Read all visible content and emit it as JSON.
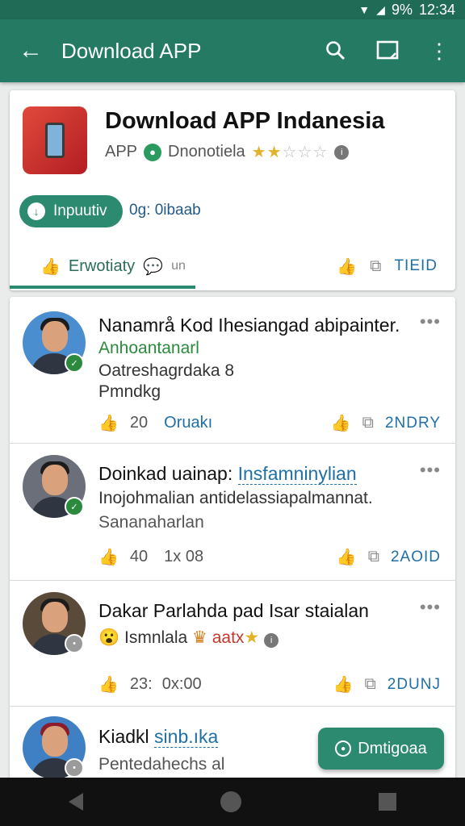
{
  "status_bar": {
    "signal": "9%",
    "time": "12:34"
  },
  "app_bar": {
    "title": "Download APP",
    "back_icon": "arrow-left-icon",
    "search_icon": "search-icon",
    "cast_icon": "cast-icon",
    "more_icon": "more-vert-icon"
  },
  "app_card": {
    "name": "Download APP Indanesia",
    "category": "APP",
    "developer": "Dnonotiela",
    "rating_stars": 2,
    "rating_max": 5,
    "install_label": "Inpuutiv",
    "size_text": "0g: 0ibaab",
    "action_left_label": "Erwotiaty",
    "action_left_secondary": "un",
    "action_right_link": "TIEID"
  },
  "posts": [
    {
      "title": "Nanamrå Kod Ihesiangad abipainter.",
      "lines": [
        "Anhoantanarl",
        "Oatreshagrdaka 8",
        "Pmndkg"
      ],
      "likes": "20",
      "mid_text": "Oruakı",
      "link": "2NDRY",
      "badge_color": "#2b8a3e",
      "avatar_bg": "#4a8ecf"
    },
    {
      "title_prefix": "Doinkad uainap:",
      "title_highlight": "Insfamninylian",
      "lines": [
        "Inojohmalian antidelassiapalmannat.",
        "Sananaharlan"
      ],
      "likes": "40",
      "mid_text": "1x 08",
      "link": "2AOID",
      "badge_color": "#2b8a3e",
      "avatar_bg": "#6b6f7a"
    },
    {
      "title": "Dakar Parlahda pad Isar staialan",
      "lines": [
        "Ismnlala"
      ],
      "tag": "aatx",
      "likes": "23:",
      "mid_text": "0x:00",
      "link": "2DUNJ",
      "badge_color": "#9a9a9a",
      "avatar_bg": "#5a4a3a"
    },
    {
      "title_prefix": "Kiadkl",
      "title_highlight": "sinb.ıka",
      "lines": [
        "Pentedahechs al"
      ],
      "badge_color": "#9a9a9a",
      "avatar_bg": "#3f7fc4"
    }
  ],
  "fab": {
    "label": "Dmtigoaa",
    "icon": "clock-icon"
  },
  "nav_bar": {
    "back": "nav-back-icon",
    "home": "nav-home-icon",
    "recents": "nav-recents-icon"
  }
}
